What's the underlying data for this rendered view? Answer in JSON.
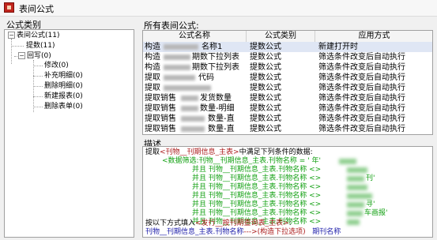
{
  "window": {
    "title": "表间公式"
  },
  "left_panel": {
    "label": "公式类别",
    "root": {
      "label": "表间公式(11)",
      "expander": "−"
    },
    "children": [
      {
        "label": "提数(11)"
      },
      {
        "label": "回写(0)",
        "expander": "−"
      }
    ],
    "writeback_children": [
      {
        "label": "修改(0)"
      },
      {
        "label": "补充明细(0)"
      },
      {
        "label": "删除明细(0)"
      },
      {
        "label": "新建报表(0)"
      },
      {
        "label": "删除表单(0)"
      }
    ]
  },
  "formula_list": {
    "label": "所有表间公式:",
    "columns": [
      "公式名称",
      "公式类别",
      "应用方式"
    ],
    "rows": [
      {
        "name": "构造",
        "name_tail": "名称1",
        "category": "提数公式",
        "mode": "新建打开时",
        "selected": true
      },
      {
        "name": "构造",
        "name_tail": "期数下拉列表",
        "category": "提数公式",
        "mode": "筛选条件改变后自动执行"
      },
      {
        "name": "构造",
        "name_tail": "期数下拉列表",
        "category": "提数公式",
        "mode": "筛选条件改变后自动执行"
      },
      {
        "name": "提取",
        "name_tail": "代码",
        "category": "提数公式",
        "mode": "筛选条件改变后自动执行"
      },
      {
        "name": "提取",
        "name_tail": "",
        "category": "提数公式",
        "mode": "筛选条件改变后自动执行"
      },
      {
        "name": "提取销售",
        "name_tail": "发货数量",
        "category": "提数公式",
        "mode": "筛选条件改变后自动执行"
      },
      {
        "name": "提取销售",
        "name_tail": "数量-明细",
        "category": "提数公式",
        "mode": "筛选条件改变后自动执行"
      },
      {
        "name": "提取销售",
        "name_tail": "数量-直",
        "category": "提数公式",
        "mode": "筛选条件改变后自动执行"
      },
      {
        "name": "提取销售",
        "name_tail": "数量-直",
        "category": "提数公式",
        "mode": "筛选条件改变后自动执行"
      }
    ]
  },
  "description": {
    "label": "描述",
    "line1": {
      "a": "提取",
      "b": "<刊物__刊期信息_主表>",
      "c": "中满足下列条件的数据:"
    },
    "line2": "<数据筛选:刊物__刊期信息_主表.刊物名称 = '                  年'",
    "cond_lines": [
      "并且 刊物__刊期信息_主表.刊物名称 <>",
      "并且 刊物__刊期信息_主表.刊物名称 <>",
      "并且 刊物__刊期信息_主表.刊物名称 <>",
      "并且 刊物__刊期信息_主表.刊物名称 <>",
      "并且 刊物__刊期信息_主表.刊物名称 <>",
      "并且 刊物__刊期信息_主表.刊物名称 <>",
      "并且 刊物__刊期信息_主表.刊物名称 <>"
    ],
    "cond_tails": [
      "",
      "刊'",
      "",
      "",
      "寻'",
      "车画报'",
      ""
    ],
    "line_end1": {
      "a": "按以下方式填入",
      "b": "<发行__按刊期查询表_主表>",
      "c": ":"
    },
    "line_end2": {
      "a": "刊物__刊期信息_主表.刊物名称",
      "b": "--->",
      "c": "(构造下拉选项)",
      "d": "期刊名称"
    }
  }
}
